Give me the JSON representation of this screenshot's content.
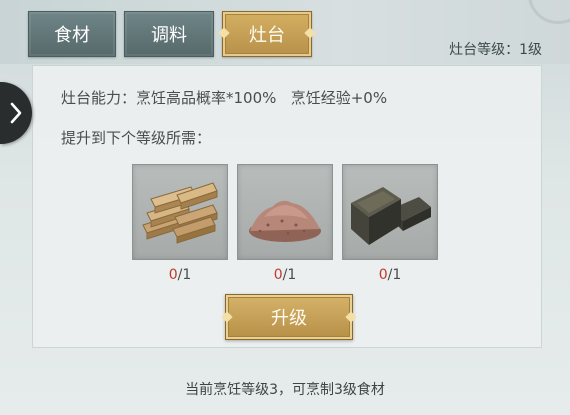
{
  "tabs": [
    {
      "label": "食材",
      "active": false
    },
    {
      "label": "调料",
      "active": false
    },
    {
      "label": "灶台",
      "active": true
    }
  ],
  "stove_level": "灶台等级：1级",
  "ability": {
    "label": "灶台能力：",
    "chance": "烹饪高品概率*100%",
    "exp": "烹饪经验+0%"
  },
  "requirement_heading": "提升到下个等级所需：",
  "materials": [
    {
      "icon": "wood-planks-icon",
      "have": "0",
      "need": "1"
    },
    {
      "icon": "red-powder-icon",
      "have": "0",
      "need": "1"
    },
    {
      "icon": "iron-ingot-icon",
      "have": "0",
      "need": "1"
    }
  ],
  "count_separator": "/",
  "upgrade_label": "升级",
  "footer": "当前烹饪等级3，可烹制3级食材",
  "colors": {
    "accent_gold": "#c9a45a",
    "tab_slate": "#617678",
    "missing_red": "#c0392b"
  }
}
